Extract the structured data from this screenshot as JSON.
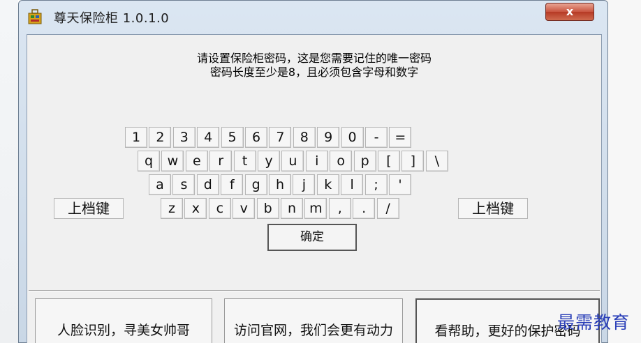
{
  "window": {
    "title": "尊天保险柜 1.0.1.0",
    "close_label": "x"
  },
  "message": {
    "line1": "请设置保险柜密码，这是您需要记住的唯一密码",
    "line2": "密码长度至少是8，且必须包含字母和数字"
  },
  "keyboard": {
    "rows": [
      [
        "1",
        "2",
        "3",
        "4",
        "5",
        "6",
        "7",
        "8",
        "9",
        "0",
        "-",
        "="
      ],
      [
        "q",
        "w",
        "e",
        "r",
        "t",
        "y",
        "u",
        "i",
        "o",
        "p",
        "[",
        "]",
        "\\"
      ],
      [
        "a",
        "s",
        "d",
        "f",
        "g",
        "h",
        "j",
        "k",
        "l",
        ";",
        "'"
      ],
      [
        "z",
        "x",
        "c",
        "v",
        "b",
        "n",
        "m",
        ",",
        ".",
        "/"
      ]
    ],
    "shift_label": "上档键",
    "confirm_label": "确定"
  },
  "bottom_buttons": {
    "face": "人脸识别，寻美女帅哥",
    "website": "访问官网，我们会更有动力",
    "help": "看帮助，更好的保护密码"
  },
  "watermark": "最需教育",
  "colors": {
    "watermark": "#2a3fb8",
    "close_button": "#c9543f"
  }
}
